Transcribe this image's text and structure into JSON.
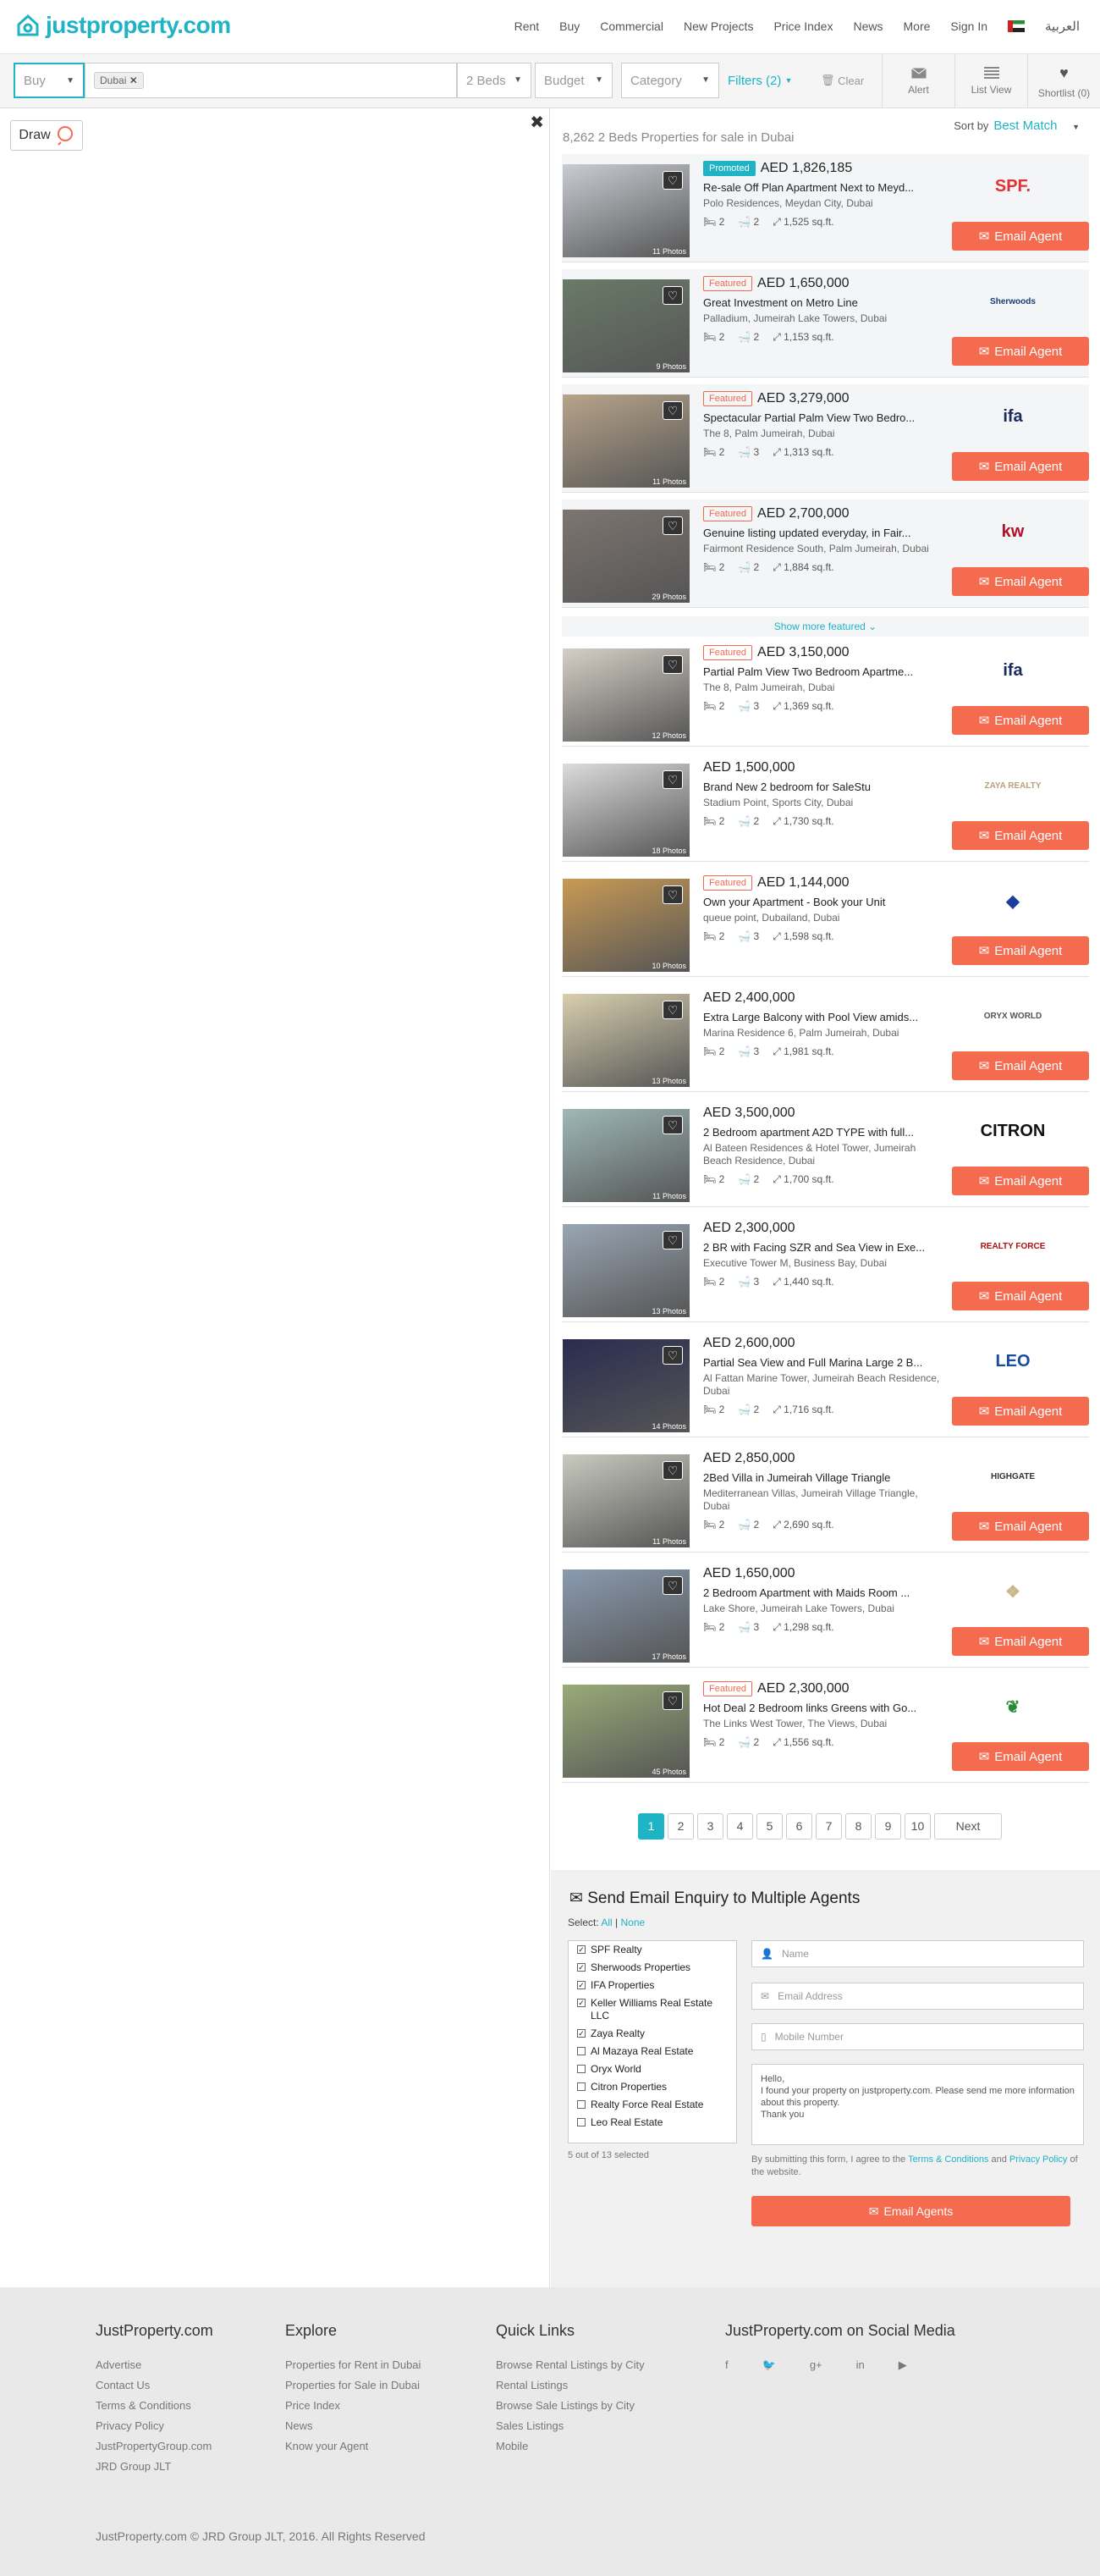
{
  "logo": "justproperty.com",
  "nav": [
    "Rent",
    "Buy",
    "Commercial",
    "New Projects",
    "Price Index",
    "News",
    "More",
    "Sign In"
  ],
  "lang": "العربية",
  "search": {
    "mode": "Buy",
    "location": "Dubai",
    "beds": "2 Beds",
    "budget": "Budget",
    "category": "Category",
    "filters": "Filters (2)",
    "clear": "Clear"
  },
  "actions": {
    "alert": "Alert",
    "list": "List View",
    "shortlist": "Shortlist (0)"
  },
  "map": {
    "draw": "Draw"
  },
  "results": {
    "heading": "8,262 2 Beds Properties for sale in Dubai",
    "sort_label": "Sort by",
    "sort_value": "Best Match",
    "show_more": "Show more featured"
  },
  "email_label": "Email Agent",
  "listings": [
    {
      "badge": "Promoted",
      "price": "AED 1,826,185",
      "title": "Re-sale Off Plan Apartment Next to Meyd...",
      "location": "Polo Residences, Meydan City, Dubai",
      "beds": "2",
      "baths": "2",
      "area": "1,525 sq.ft.",
      "photos": "11 Photos",
      "agent": "SPF.",
      "agent_color": "#d33",
      "promo": true
    },
    {
      "badge": "Featured",
      "price": "AED 1,650,000",
      "title": "Great Investment on Metro Line",
      "location": "Palladium, Jumeirah Lake Towers, Dubai",
      "beds": "2",
      "baths": "2",
      "area": "1,153 sq.ft.",
      "photos": "9 Photos",
      "agent": "Sherwoods",
      "agent_color": "#1a3d6e",
      "promo": true
    },
    {
      "badge": "Featured",
      "price": "AED 3,279,000",
      "title": "Spectacular Partial Palm View Two Bedro...",
      "location": "The 8, Palm Jumeirah, Dubai",
      "beds": "2",
      "baths": "3",
      "area": "1,313 sq.ft.",
      "photos": "11 Photos",
      "agent": "ifa",
      "agent_color": "#1a2a5e",
      "promo": true
    },
    {
      "badge": "Featured",
      "price": "AED 2,700,000",
      "title": "Genuine listing updated everyday, in Fair...",
      "location": "Fairmont Residence South, Palm Jumeirah, Dubai",
      "beds": "2",
      "baths": "2",
      "area": "1,884 sq.ft.",
      "photos": "29 Photos",
      "agent": "kw",
      "agent_color": "#b0112a",
      "promo": true
    },
    {
      "badge": "Featured",
      "price": "AED 3,150,000",
      "title": "Partial Palm View Two Bedroom Apartme...",
      "location": "The 8, Palm Jumeirah, Dubai",
      "beds": "2",
      "baths": "3",
      "area": "1,369 sq.ft.",
      "photos": "12 Photos",
      "agent": "ifa",
      "agent_color": "#1a2a5e",
      "promo": false
    },
    {
      "badge": "",
      "price": "AED 1,500,000",
      "title": "Brand New 2 bedroom for SaleStu",
      "location": "Stadium Point, Sports City, Dubai",
      "beds": "2",
      "baths": "2",
      "area": "1,730 sq.ft.",
      "photos": "18 Photos",
      "agent": "ZAYA REALTY",
      "agent_color": "#b9a27a",
      "promo": false
    },
    {
      "badge": "Featured",
      "price": "AED 1,144,000",
      "title": "Own your Apartment - Book your Unit",
      "location": "queue point, Dubailand, Dubai",
      "beds": "2",
      "baths": "3",
      "area": "1,598 sq.ft.",
      "photos": "10 Photos",
      "agent": "◆",
      "agent_color": "#1a3d9e",
      "promo": false
    },
    {
      "badge": "",
      "price": "AED 2,400,000",
      "title": "Extra Large Balcony with Pool View amids...",
      "location": "Marina Residence 6, Palm Jumeirah, Dubai",
      "beds": "2",
      "baths": "3",
      "area": "1,981 sq.ft.",
      "photos": "13 Photos",
      "agent": "ORYX WORLD",
      "agent_color": "#555",
      "promo": false
    },
    {
      "badge": "",
      "price": "AED 3,500,000",
      "title": "2 Bedroom apartment A2D TYPE with full...",
      "location": "Al Bateen Residences & Hotel Tower, Jumeirah Beach Residence, Dubai",
      "beds": "2",
      "baths": "2",
      "area": "1,700 sq.ft.",
      "photos": "11 Photos",
      "agent": "CITRON",
      "agent_color": "#111",
      "promo": false
    },
    {
      "badge": "",
      "price": "AED 2,300,000",
      "title": "2 BR with Facing SZR and Sea View in Exe...",
      "location": "Executive Tower M, Business Bay, Dubai",
      "beds": "2",
      "baths": "3",
      "area": "1,440 sq.ft.",
      "photos": "13 Photos",
      "agent": "REALTY FORCE",
      "agent_color": "#a11",
      "promo": false
    },
    {
      "badge": "",
      "price": "AED 2,600,000",
      "title": "Partial Sea View and Full Marina Large 2 B...",
      "location": "Al Fattan Marine Tower, Jumeirah Beach Residence, Dubai",
      "beds": "2",
      "baths": "2",
      "area": "1,716 sq.ft.",
      "photos": "14 Photos",
      "agent": "LEO",
      "agent_color": "#1a4da0",
      "promo": false
    },
    {
      "badge": "",
      "price": "AED 2,850,000",
      "title": "2Bed Villa in Jumeirah Village Triangle",
      "location": "Mediterranean Villas, Jumeirah Village Triangle, Dubai",
      "beds": "2",
      "baths": "2",
      "area": "2,690 sq.ft.",
      "photos": "11 Photos",
      "agent": "HIGHGATE",
      "agent_color": "#333",
      "promo": false
    },
    {
      "badge": "",
      "price": "AED 1,650,000",
      "title": "2 Bedroom Apartment with Maids Room ...",
      "location": "Lake Shore, Jumeirah Lake Towers, Dubai",
      "beds": "2",
      "baths": "3",
      "area": "1,298 sq.ft.",
      "photos": "17 Photos",
      "agent": "❖",
      "agent_color": "#c9b98a",
      "promo": false
    },
    {
      "badge": "Featured",
      "price": "AED 2,300,000",
      "title": "Hot Deal 2 Bedroom links Greens with Go...",
      "location": "The Links West Tower, The Views, Dubai",
      "beds": "2",
      "baths": "2",
      "area": "1,556 sq.ft.",
      "photos": "45 Photos",
      "agent": "❦",
      "agent_color": "#2a8a3a",
      "promo": false
    }
  ],
  "pagination": [
    "1",
    "2",
    "3",
    "4",
    "5",
    "6",
    "7",
    "8",
    "9",
    "10",
    "Next"
  ],
  "enquiry": {
    "title": "Send Email Enquiry to Multiple Agents",
    "select_label": "Select:",
    "all": "All",
    "none": "None",
    "agents": [
      {
        "name": "SPF Realty",
        "checked": true
      },
      {
        "name": "Sherwoods Properties",
        "checked": true
      },
      {
        "name": "IFA Properties",
        "checked": true
      },
      {
        "name": "Keller Williams Real Estate LLC",
        "checked": true
      },
      {
        "name": "Zaya Realty",
        "checked": true
      },
      {
        "name": "Al Mazaya Real Estate",
        "checked": false
      },
      {
        "name": "Oryx World",
        "checked": false
      },
      {
        "name": "Citron Properties",
        "checked": false
      },
      {
        "name": "Realty Force Real Estate",
        "checked": false
      },
      {
        "name": "Leo Real Estate",
        "checked": false
      }
    ],
    "count": "5 out of 13 selected",
    "name_ph": "Name",
    "email_ph": "Email Address",
    "mobile_ph": "Mobile Number",
    "message": "Hello,\nI found your property on justproperty.com. Please send me more information about this property.\nThank you",
    "terms_pre": "By submitting this form, I agree to the",
    "terms_link": "Terms & Conditions",
    "terms_and": "and",
    "privacy_link": "Privacy Policy",
    "terms_post": "of the website.",
    "send": "Email Agents"
  },
  "footer": {
    "col1": {
      "title": "JustProperty.com",
      "links": [
        "Advertise",
        "Contact Us",
        "Terms & Conditions",
        "Privacy Policy",
        "JustPropertyGroup.com",
        "JRD Group JLT"
      ]
    },
    "col2": {
      "title": "Explore",
      "links": [
        "Properties for Rent in Dubai",
        "Properties for Sale in Dubai",
        "Price Index",
        "News",
        "Know your Agent"
      ]
    },
    "col3": {
      "title": "Quick Links",
      "links": [
        "Browse Rental Listings by City",
        "Rental Listings",
        "Browse Sale Listings by City",
        "Sales Listings",
        "Mobile"
      ]
    },
    "col4": {
      "title": "JustProperty.com on Social Media"
    },
    "copyright": "JustProperty.com © JRD Group JLT, 2016. All Rights Reserved"
  },
  "colors": {
    "brand": "#1fb3c6",
    "cta": "#f46b4f"
  }
}
